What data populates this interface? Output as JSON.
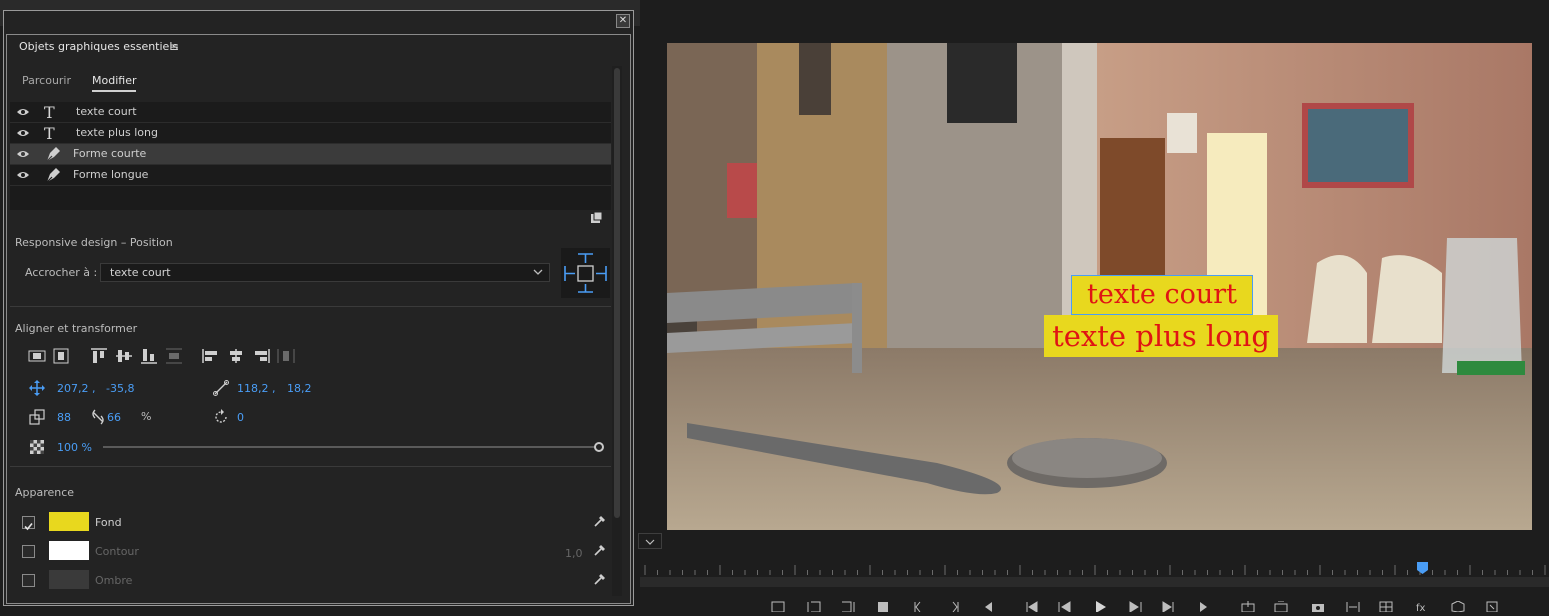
{
  "panel": {
    "title": "Objets graphiques essentiels",
    "tabs": [
      {
        "label": "Parcourir",
        "active": false
      },
      {
        "label": "Modifier",
        "active": true
      }
    ],
    "layers": [
      {
        "label": "texte court",
        "type": "text",
        "selected": false
      },
      {
        "label": "texte plus long",
        "type": "text",
        "selected": false
      },
      {
        "label": "Forme courte",
        "type": "shape",
        "selected": true
      },
      {
        "label": "Forme longue",
        "type": "shape",
        "selected": false
      }
    ],
    "responsive": {
      "section_title": "Responsive design – Position",
      "pin_label": "Accrocher à :",
      "pin_value": "texte court"
    },
    "align": {
      "section_title": "Aligner et transformer",
      "position_x": "207,2 ,",
      "position_y": "-35,8",
      "anchor_x": "118,2 ,",
      "anchor_y": "18,2",
      "scale_w": "88",
      "scale_h": "66",
      "scale_unit": "%",
      "rotation": "0",
      "opacity": "100 %",
      "opacity_level": 1.0
    },
    "appearance": {
      "section_title": "Apparence",
      "items": [
        {
          "label": "Fond",
          "checked": true,
          "color": "#e8d81e"
        },
        {
          "label": "Contour",
          "checked": false,
          "color": "#ffffff",
          "width": "1,0"
        },
        {
          "label": "Ombre",
          "checked": false,
          "color": "#3a3a3a"
        }
      ]
    }
  },
  "monitor": {
    "captions": [
      {
        "text": "texte court",
        "bg": "#e8d81e",
        "color": "#e01414",
        "selected": true
      },
      {
        "text": "texte plus long",
        "bg": "#e8d81e",
        "color": "#e01414",
        "selected": false
      }
    ]
  },
  "colors": {
    "accent": "#4a9df5",
    "panel_bg": "#232323",
    "app_bg": "#1d1d1d"
  }
}
